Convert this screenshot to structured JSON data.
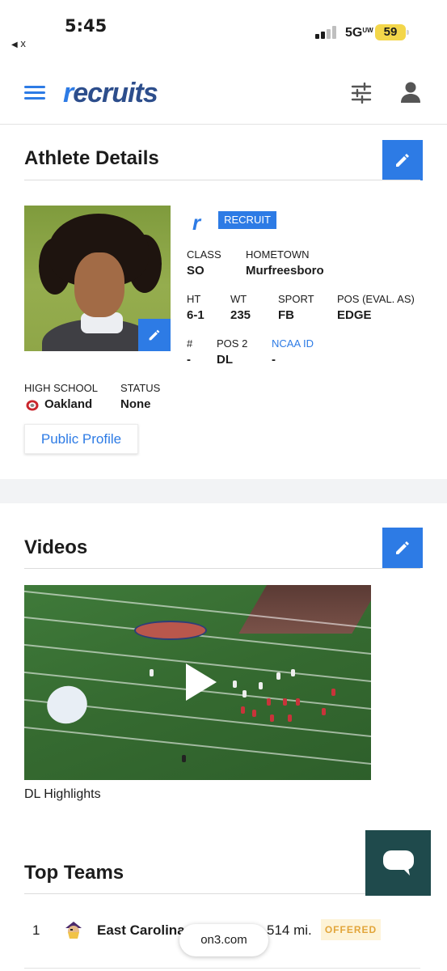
{
  "status_bar": {
    "time": "5:45",
    "back_label": "x",
    "network": "5G",
    "network_sub": "UW",
    "battery": "59"
  },
  "header": {
    "logo_text_first": "r",
    "logo_text_rest": "ecruits",
    "icons": [
      "menu-icon",
      "filter-icon",
      "user-icon"
    ],
    "accent_color": "#2d7be5"
  },
  "athlete": {
    "section_title": "Athlete Details",
    "badge": "RECRUIT",
    "badge_logo": "r",
    "fields": {
      "class": {
        "label": "CLASS",
        "value": "SO"
      },
      "hometown": {
        "label": "HOMETOWN",
        "value": "Murfreesboro"
      },
      "ht": {
        "label": "HT",
        "value": "6-1"
      },
      "wt": {
        "label": "WT",
        "value": "235"
      },
      "sport": {
        "label": "SPORT",
        "value": "FB"
      },
      "pos": {
        "label": "POS (EVAL. AS)",
        "value": "EDGE"
      },
      "number": {
        "label": "#",
        "value": "-"
      },
      "pos2": {
        "label": "POS 2",
        "value": "DL"
      },
      "ncaa": {
        "label": "NCAA ID",
        "value": "-"
      },
      "high_school": {
        "label": "HIGH SCHOOL",
        "value": "Oakland"
      },
      "status": {
        "label": "STATUS",
        "value": "None"
      }
    },
    "public_profile_label": "Public Profile"
  },
  "videos": {
    "section_title": "Videos",
    "items": [
      {
        "caption": "DL Highlights"
      }
    ]
  },
  "top_teams": {
    "section_title": "Top Teams",
    "rows": [
      {
        "rank": "1",
        "name": "East Carolina",
        "distance": "514 mi.",
        "status": "OFFERED"
      }
    ]
  },
  "browser": {
    "url": "on3.com"
  }
}
